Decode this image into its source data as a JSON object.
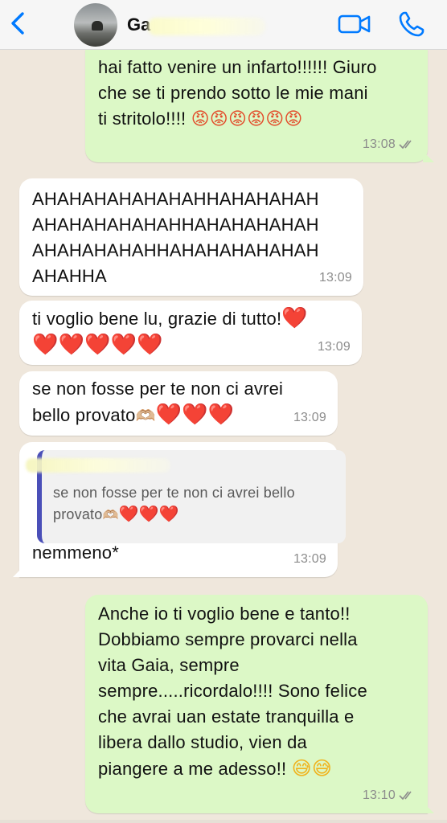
{
  "header": {
    "contact_name": "Ga",
    "back_icon": "chevron-left-icon",
    "video_icon": "video-camera-icon",
    "call_icon": "phone-icon",
    "accent": "#007aff"
  },
  "messages": [
    {
      "dir": "out",
      "lines": [
        "hai fatto venire un infarto!!!!!! Giuro",
        "che se ti prendo sotto le mie mani",
        "ti stritolo!!!! "
      ],
      "emoji": "😡😡😡😡😡😡",
      "time": "13:08"
    },
    {
      "dir": "in",
      "lines": [
        "AHAHAHAHAHAHAHHAHAHAHAH",
        "AHAHAHAHAHAHHAHAHAHAHAH",
        "AHAHAHAHAHHAHAHAHAHAHAH",
        "AHAHHA"
      ],
      "time": "13:09"
    },
    {
      "dir": "in",
      "line1": "ti voglio bene lu, grazie di tutto!",
      "hearts1": "❤️",
      "hearts2": "❤️❤️❤️❤️❤️",
      "time": "13:09"
    },
    {
      "dir": "in",
      "line1": "se non fosse per te non ci avrei",
      "line2": "bello provato",
      "hands": "🫶🏼",
      "hearts": "❤️❤️❤️",
      "time": "13:09"
    },
    {
      "dir": "in",
      "quote_line1": "se non fosse per te non ci avrei bello",
      "quote_line2": "provato",
      "quote_hands": "🫶🏼",
      "quote_hearts": "❤️❤️❤️",
      "text": "nemmeno*",
      "time": "13:09"
    },
    {
      "dir": "out",
      "lines": [
        "Anche io ti voglio bene e tanto!!",
        "Dobbiamo sempre provarci nella",
        "vita Gaia, sempre",
        "sempre.....ricordalo!!!! Sono felice",
        "che avrai uan estate tranquilla e",
        "libera dallo studio, vien da",
        "piangere a me adesso!! "
      ],
      "emoji": "😅😅",
      "time": "13:10"
    }
  ],
  "colors": {
    "outgoing_bubble": "#dcf8c6",
    "incoming_bubble": "#ffffff",
    "chat_background": "#efe7dc",
    "quote_bar": "#4a4fb8"
  }
}
